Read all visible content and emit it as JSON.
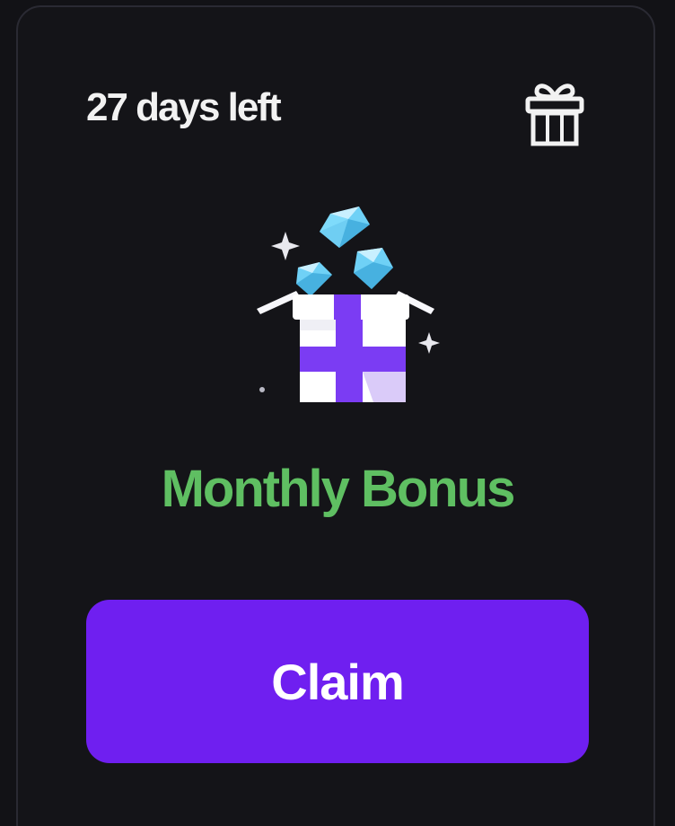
{
  "card": {
    "days_left": "27 days left",
    "gift_icon": "gift-outline-icon",
    "illustration": "gift-box-diamonds-illustration",
    "title": "Monthly Bonus",
    "claim_label": "Claim"
  },
  "colors": {
    "background": "#121216",
    "card_background": "#141418",
    "card_border": "#2a2a33",
    "title_green": "#5fbf62",
    "button_purple": "#6f1ff0",
    "text_white": "#f2f2f2"
  }
}
